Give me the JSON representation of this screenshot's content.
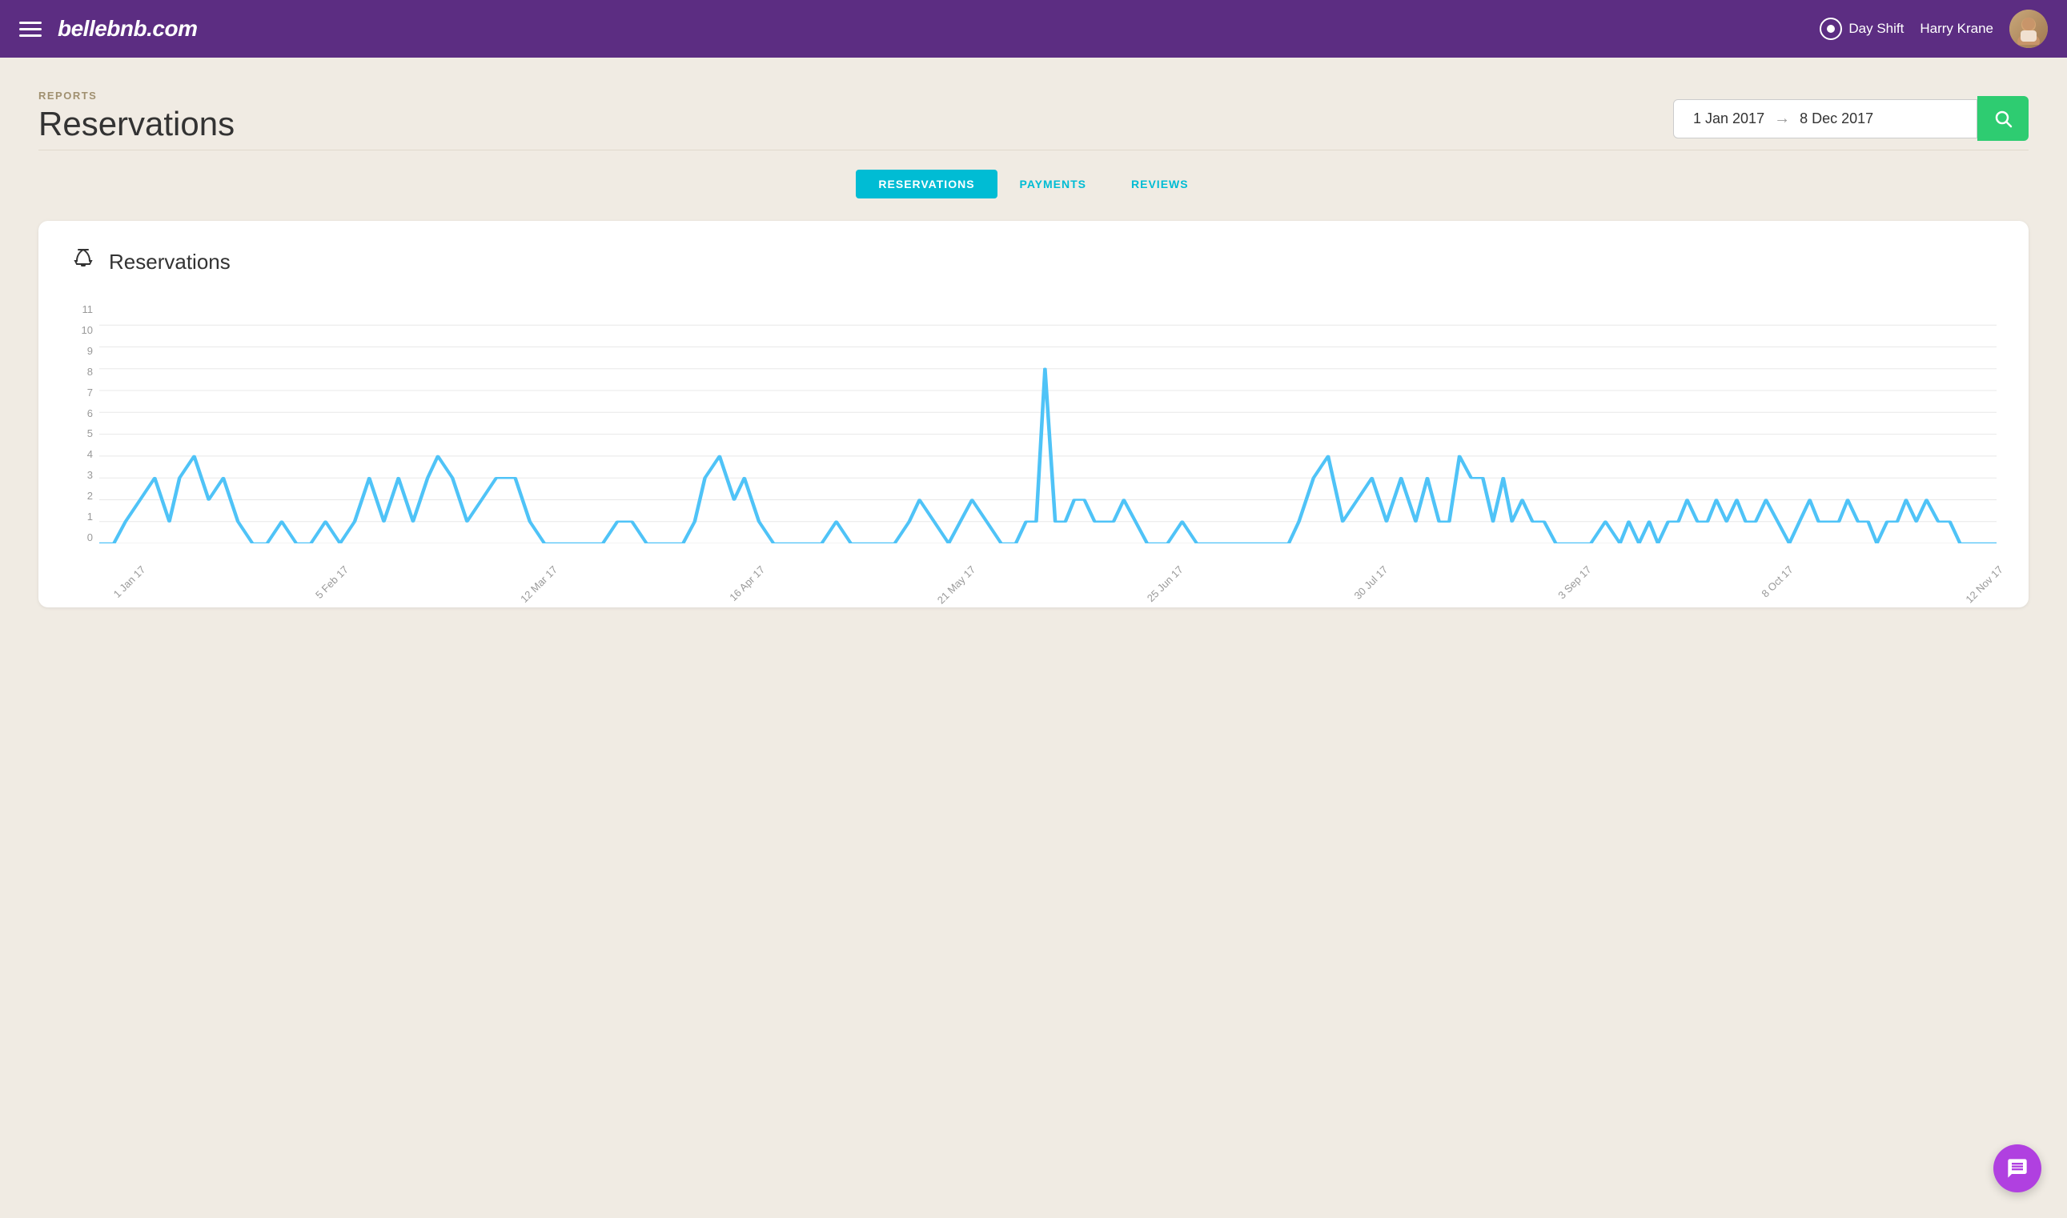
{
  "header": {
    "logo": "bellebnb.com",
    "mode": "Day Shift",
    "user_name": "Harry Krane"
  },
  "breadcrumb": "REPORTS",
  "page_title": "Reservations",
  "date_range": {
    "start": "1 Jan 2017",
    "end": "8 Dec 2017"
  },
  "tabs": [
    {
      "label": "RESERVATIONS",
      "active": true
    },
    {
      "label": "PAYMENTS",
      "active": false
    },
    {
      "label": "REVIEWS",
      "active": false
    }
  ],
  "chart": {
    "title": "Reservations",
    "y_labels": [
      "0",
      "1",
      "2",
      "3",
      "4",
      "5",
      "6",
      "7",
      "8",
      "9",
      "10",
      "11"
    ],
    "x_labels": [
      "1 Jan 17",
      "5 Feb 17",
      "12 Mar 17",
      "16 Apr 17",
      "21 May 17",
      "25 Jun 17",
      "30 Jul 17",
      "3 Sep 17",
      "8 Oct 17",
      "12 Nov 17"
    ]
  },
  "search_button_label": "Search",
  "chat_button_label": "Chat"
}
